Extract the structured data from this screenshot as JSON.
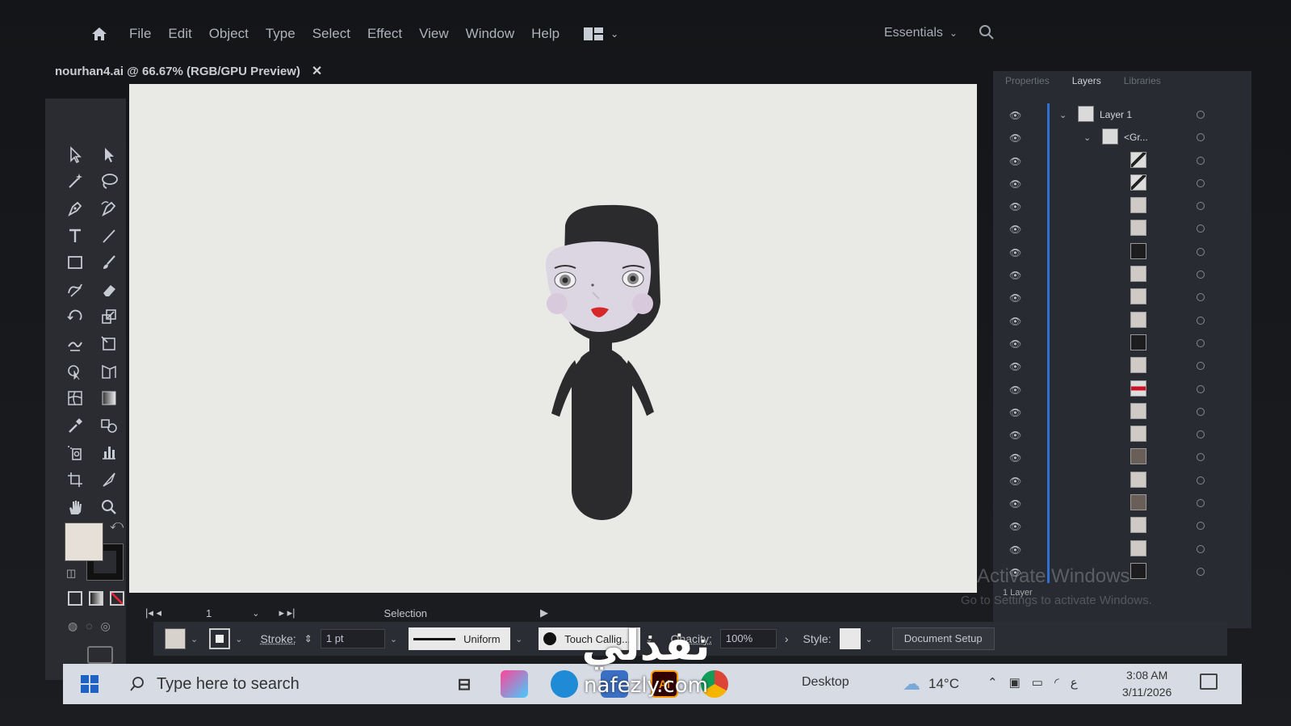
{
  "menubar": {
    "items": [
      "File",
      "Edit",
      "Object",
      "Type",
      "Select",
      "Effect",
      "View",
      "Window",
      "Help"
    ],
    "workspace": "Essentials"
  },
  "document": {
    "tab_title": "nourhan4.ai @ 66.67% (RGB/GPU Preview)",
    "close_glyph": "✕"
  },
  "layers_panel": {
    "tabs": [
      "Properties",
      "Layers",
      "Libraries"
    ],
    "active_tab": "Layers",
    "layer_name": "Layer 1",
    "group_name": "<Gr...",
    "footer": "1 Layer",
    "thumbs": [
      "stripe",
      "stripe",
      "light",
      "light",
      "dark",
      "light",
      "light",
      "light",
      "dark",
      "light",
      "red",
      "light",
      "light",
      "brown",
      "light",
      "brown",
      "light",
      "light",
      "dark"
    ]
  },
  "statusbar": {
    "artboard_number": "1",
    "tool": "Selection"
  },
  "controlbar": {
    "stroke_label": "Stroke:",
    "stroke_value": "1 pt",
    "profile": "Uniform",
    "brush": "Touch Callig...",
    "opacity_label": "Opacity:",
    "opacity_value": "100%",
    "style_label": "Style:",
    "document_setup": "Document Setup"
  },
  "watermark": {
    "line1": "Activate Windows",
    "line2": "Go to Settings to activate Windows."
  },
  "taskbar": {
    "search_placeholder": "Type here to search",
    "desktop_label": "Desktop",
    "temperature": "14°C",
    "time": "3:08 AM",
    "date": "3/11/2026",
    "ai_label": "Ai"
  },
  "brand": {
    "arabic": "نفذلي",
    "url": "nafezly.com"
  },
  "colors": {
    "artboard": "#e9e9e6",
    "figure": "#2b2b2d",
    "face": "#dcd6e2",
    "lips": "#d62828"
  }
}
